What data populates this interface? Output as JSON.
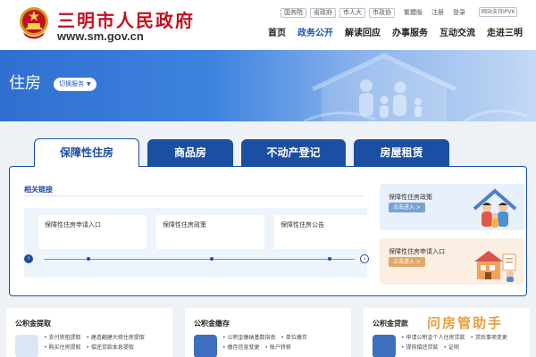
{
  "header": {
    "site_title": "三明市人民政府",
    "site_url": "www.sm.gov.cn",
    "top_links": [
      "国务院",
      "省政府",
      "市人大",
      "市政协"
    ],
    "lang": "繁體版",
    "register": "注册",
    "login": "登录",
    "ipv6": "网站支持IPV6",
    "nav": [
      "首页",
      "政务公开",
      "解读回应",
      "办事服务",
      "互动交流",
      "走进三明"
    ],
    "active_nav": "政务公开"
  },
  "banner": {
    "title": "住房",
    "switch_label": "切换服务"
  },
  "tabs": [
    {
      "label": "保障性住房",
      "active": true
    },
    {
      "label": "商品房",
      "active": false
    },
    {
      "label": "不动产登记",
      "active": false
    },
    {
      "label": "房屋租赁",
      "active": false
    }
  ],
  "panel": {
    "label": "相关链接",
    "links": [
      "保障性住房申请入口",
      "保障性住房政策",
      "保障性住房公告"
    ],
    "prev": "‹",
    "next": "›",
    "promos": [
      {
        "title": "保障性住房政策",
        "button": "点击进入 >"
      },
      {
        "title": "保障性住房申请入口",
        "button": "点击进入 >"
      }
    ]
  },
  "bottom_cards": [
    {
      "title": "公积金提取",
      "links": [
        [
          "支付房租提取",
          "建造翻建大修住房提取"
        ],
        [
          "购买住房提取",
          "偿还贷款本息提取"
        ]
      ]
    },
    {
      "title": "公积金缴存",
      "links": [
        [
          "公积金缴纳基数指南",
          "单位缴存"
        ],
        [
          "缴存信息变更",
          "账户转移"
        ]
      ]
    },
    {
      "title": "公积金贷款",
      "links": [
        [
          "申请公积金个人住房贷款",
          "贷后事项变更"
        ],
        [
          "提前偿还贷款",
          "证明"
        ]
      ]
    }
  ],
  "watermark": "问房管助手",
  "colors": {
    "brand_red": "#c0111f",
    "brand_blue": "#1b4fa3",
    "nav_active": "#1a56b8",
    "watermark": "#e3a044"
  }
}
